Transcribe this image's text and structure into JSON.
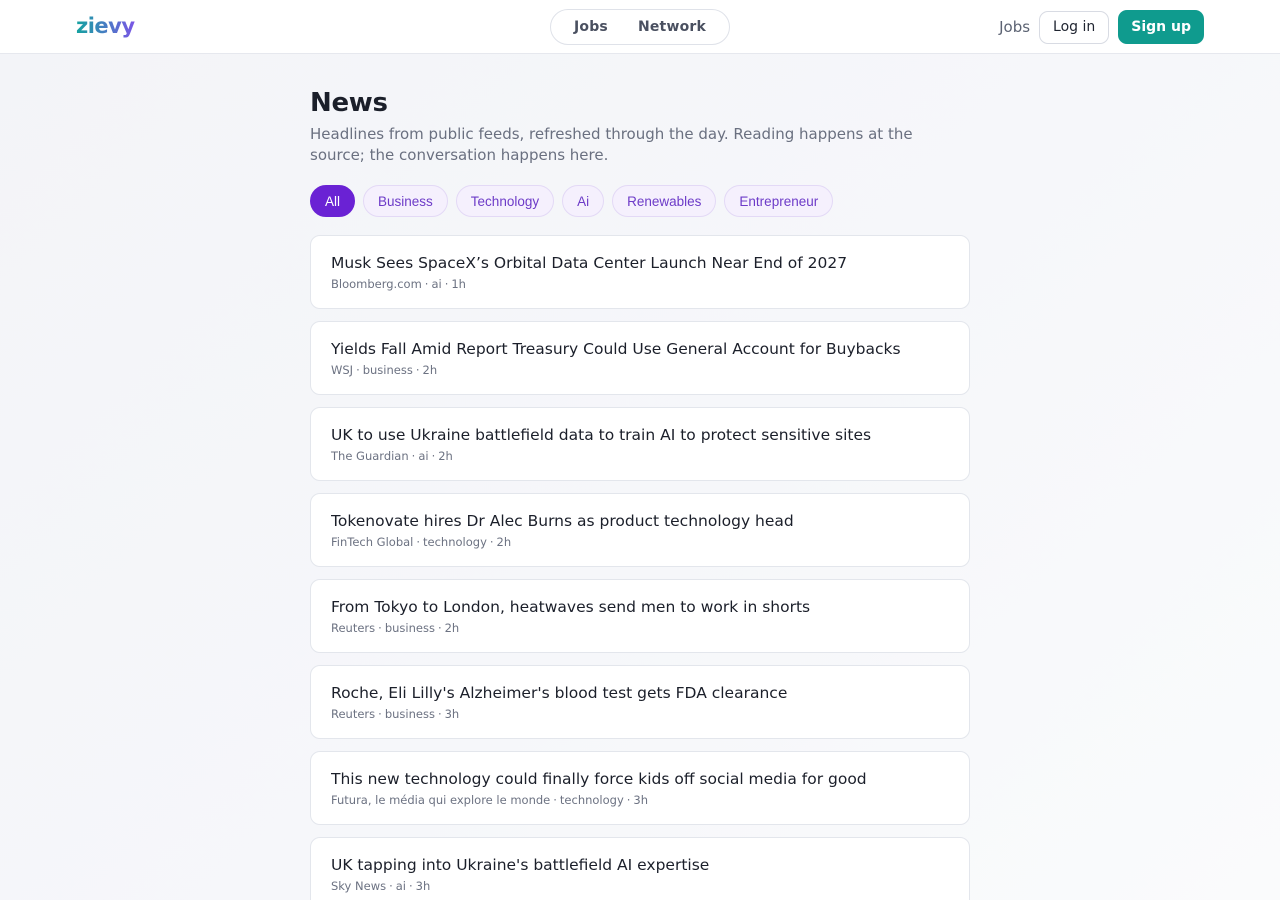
{
  "header": {
    "logo": "zievy",
    "center_nav": [
      {
        "label": "Jobs"
      },
      {
        "label": "Network"
      }
    ],
    "jobs_link": "Jobs",
    "login_label": "Log in",
    "signup_label": "Sign up"
  },
  "page": {
    "title": "News",
    "subtitle": "Headlines from public feeds, refreshed through the day. Reading happens at the source; the conversation happens here."
  },
  "filters": [
    {
      "label": "All",
      "active": true
    },
    {
      "label": "Business",
      "active": false
    },
    {
      "label": "Technology",
      "active": false
    },
    {
      "label": "Ai",
      "active": false
    },
    {
      "label": "Renewables",
      "active": false
    },
    {
      "label": "Entrepreneur",
      "active": false
    }
  ],
  "articles": [
    {
      "title": "Musk Sees SpaceX’s Orbital Data Center Launch Near End of 2027",
      "source": "Bloomberg.com",
      "category": "ai",
      "age": "1h"
    },
    {
      "title": "Yields Fall Amid Report Treasury Could Use General Account for Buybacks",
      "source": "WSJ",
      "category": "business",
      "age": "2h"
    },
    {
      "title": "UK to use Ukraine battlefield data to train AI to protect sensitive sites",
      "source": "The Guardian",
      "category": "ai",
      "age": "2h"
    },
    {
      "title": "Tokenovate hires Dr Alec Burns as product technology head",
      "source": "FinTech Global",
      "category": "technology",
      "age": "2h"
    },
    {
      "title": "From Tokyo to London, heatwaves send men to work in shorts",
      "source": "Reuters",
      "category": "business",
      "age": "2h"
    },
    {
      "title": "Roche, Eli Lilly's Alzheimer's blood test gets FDA clearance",
      "source": "Reuters",
      "category": "business",
      "age": "3h"
    },
    {
      "title": "This new technology could finally force kids off social media for good",
      "source": "Futura, le média qui explore le monde",
      "category": "technology",
      "age": "3h"
    },
    {
      "title": "UK tapping into Ukraine's battlefield AI expertise",
      "source": "Sky News",
      "category": "ai",
      "age": "3h"
    }
  ],
  "colors": {
    "brand_teal": "#0f9b8e",
    "brand_purple": "#6a22d4",
    "chip_text": "#6d3bc8"
  }
}
